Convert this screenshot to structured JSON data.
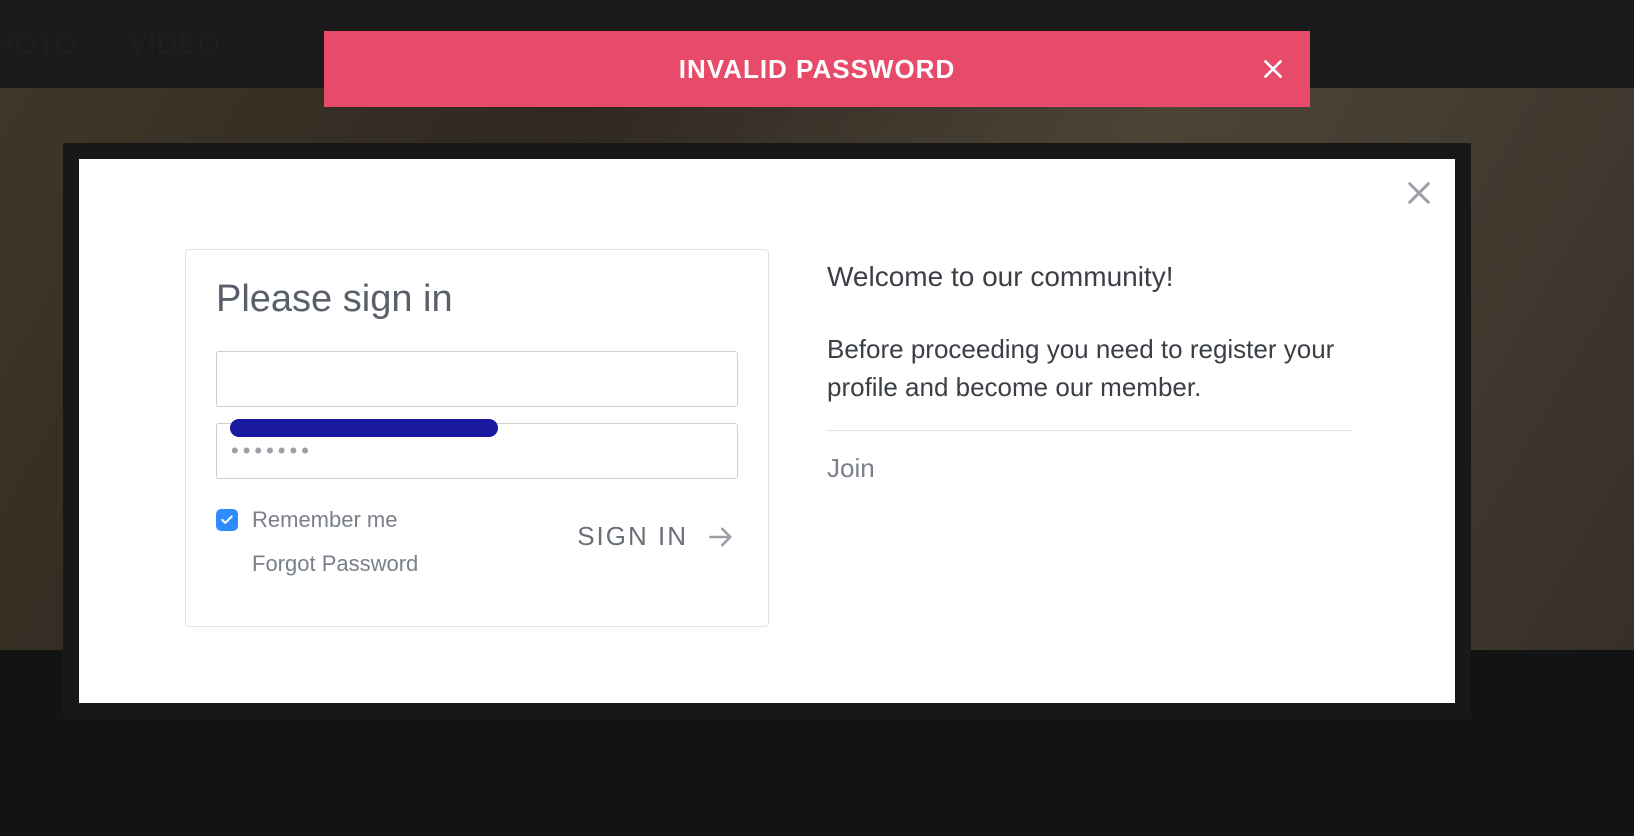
{
  "nav": {
    "items": [
      "HOTO",
      "VIDEO"
    ]
  },
  "alert": {
    "message": "INVALID PASSWORD"
  },
  "signin": {
    "title": "Please sign in",
    "username_value": "",
    "password_value": "•••••••",
    "remember_label": "Remember me",
    "remember_checked": true,
    "forgot_label": "Forgot Password",
    "submit_label": "SIGN IN"
  },
  "welcome": {
    "title": "Welcome to our community!",
    "body": "Before proceeding you need to register your profile and become our member.",
    "join_label": "Join"
  }
}
